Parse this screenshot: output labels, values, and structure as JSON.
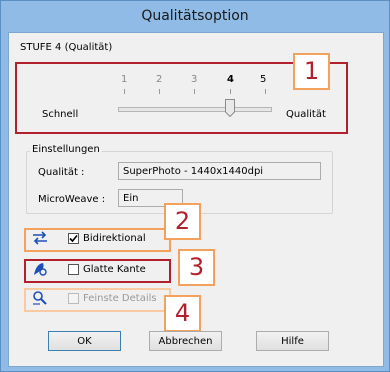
{
  "window": {
    "title": "Qualitätsoption"
  },
  "level_label": "STUFE 4 (Qualität)",
  "slider": {
    "ticks": [
      "1",
      "2",
      "3",
      "4",
      "5"
    ],
    "left_label": "Schnell",
    "right_label": "Qualität",
    "value": 4
  },
  "settings": {
    "title": "Einstellungen",
    "quality_label": "Qualität :",
    "quality_value": "SuperPhoto - 1440x1440dpi",
    "microweave_label": "MicroWeave :",
    "microweave_value": "Ein"
  },
  "options": {
    "bidirectional": {
      "label": "Bidirektional",
      "checked": true
    },
    "smooth_edges": {
      "label": "Glatte Kante",
      "checked": false
    },
    "fine_detail": {
      "label": "Feinste Details",
      "checked": false,
      "disabled": true
    }
  },
  "callouts": [
    "1",
    "2",
    "3",
    "4"
  ],
  "buttons": {
    "ok": "OK",
    "cancel": "Abbrechen",
    "help": "Hilfe"
  },
  "colors": {
    "annotation_red": "#b3202d",
    "annotation_orange": "#f4a15d",
    "title_bar": "#8fbbe6"
  }
}
